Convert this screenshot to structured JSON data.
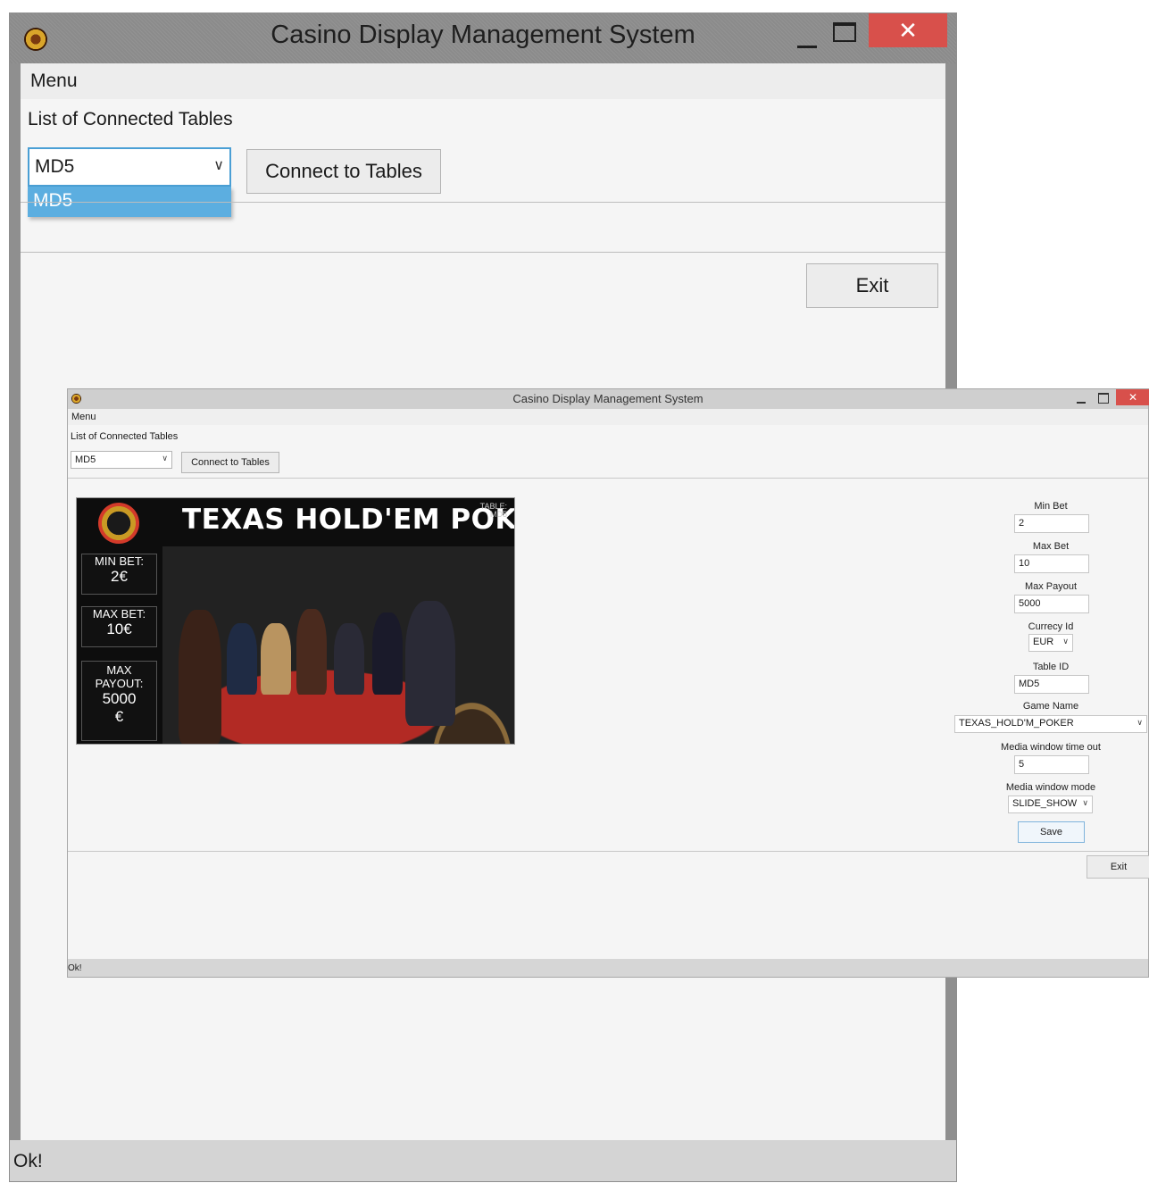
{
  "colors": {
    "close_button": "#d8504b",
    "dropdown_highlight": "#5caee0",
    "titlebar": "#8f8f8f",
    "statusbar": "#d4d4d4"
  },
  "window_large": {
    "title": "Casino Display Management System",
    "icons": [
      "casino-logo-icon",
      "minimize-icon",
      "maximize-icon",
      "close-icon"
    ],
    "close_glyph": "✕",
    "menu": "Menu",
    "list_label": "List of Connected Tables",
    "table_select": {
      "value": "MD5",
      "options": [
        "MD5"
      ]
    },
    "connect_button": "Connect to Tables",
    "exit_button": "Exit",
    "status": "Ok!"
  },
  "window_small": {
    "title": "Casino Display Management System",
    "close_glyph": "✕",
    "menu": "Menu",
    "list_label": "List of Connected Tables",
    "table_select": {
      "value": "MD5"
    },
    "connect_button": "Connect to Tables",
    "banner": {
      "game_title": "TEXAS HOLD'EM POKER",
      "table_label": "TABLE:",
      "table_value": "MD5",
      "min_bet_label": "MIN BET:",
      "min_bet_value": "2€",
      "max_bet_label": "MAX BET:",
      "max_bet_value": "10€",
      "max_payout_label": "MAX PAYOUT:",
      "max_payout_value": "5000",
      "max_payout_currency": "€"
    },
    "form": {
      "min_bet_label": "Min Bet",
      "min_bet_value": "2",
      "max_bet_label": "Max Bet",
      "max_bet_value": "10",
      "max_payout_label": "Max Payout",
      "max_payout_value": "5000",
      "currency_label": "Currecy Id",
      "currency_value": "EUR",
      "table_id_label": "Table ID",
      "table_id_value": "MD5",
      "game_name_label": "Game Name",
      "game_name_value": "TEXAS_HOLD'M_POKER",
      "media_timeout_label": "Media window time out",
      "media_timeout_value": "5",
      "media_mode_label": "Media window mode",
      "media_mode_value": "SLIDE_SHOW",
      "save_button": "Save"
    },
    "exit_button": "Exit",
    "status": "Ok!"
  }
}
